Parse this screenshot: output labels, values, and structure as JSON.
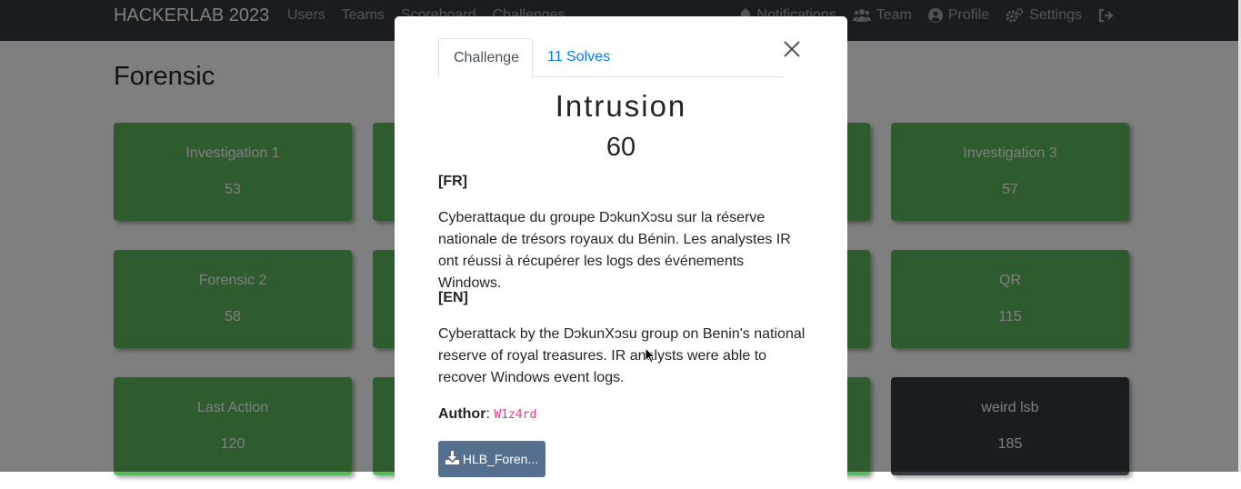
{
  "navbar": {
    "brand": "HACKERLAB 2023",
    "left_links": [
      "Users",
      "Teams",
      "Scoreboard",
      "Challenges"
    ],
    "right_links": [
      {
        "label": "Notifications",
        "icon": "bell-icon"
      },
      {
        "label": "Team",
        "icon": "users-icon"
      },
      {
        "label": "Profile",
        "icon": "user-circle-icon"
      },
      {
        "label": "Settings",
        "icon": "cogs-icon"
      },
      {
        "label": "",
        "icon": "logout-icon"
      }
    ]
  },
  "category": "Forensic",
  "cards": [
    {
      "name": "Investigation 1",
      "points": "53",
      "solved": true
    },
    {
      "name": "Investigation 3",
      "points": "57",
      "solved": true
    },
    {
      "name": "Forensic 2",
      "points": "58",
      "solved": true
    },
    {
      "name": "QR",
      "points": "115",
      "solved": true
    },
    {
      "name": "Last Action",
      "points": "120",
      "solved": true
    },
    {
      "name": "weird lsb",
      "points": "185",
      "solved": false
    }
  ],
  "modal": {
    "tabs": {
      "challenge": "Challenge",
      "solves": "11 Solves"
    },
    "name": "Intrusion",
    "value": "60",
    "fr_header": "[FR]",
    "fr_text": "Cyberattaque du groupe DɔkunXɔsu sur la réserve nationale de trésors royaux du Bénin. Les analystes IR ont réussi à récupérer les logs des événements Windows.",
    "en_header": "[EN]",
    "en_text": "Cyberattack by the DɔkunXɔsu group on Benin's national reserve of royal treasures. IR analysts were able to recover Windows event logs.",
    "author_label": "Author",
    "author_name": "W1z4rd",
    "file_label": "HLB_Foren..."
  },
  "colors": {
    "navbar": "#343a40",
    "solved_card": "#5cb85c",
    "unsolved_card": "#343a40",
    "link": "#007bff",
    "author_code": "#e83e8c",
    "file_button": "#55708f"
  }
}
